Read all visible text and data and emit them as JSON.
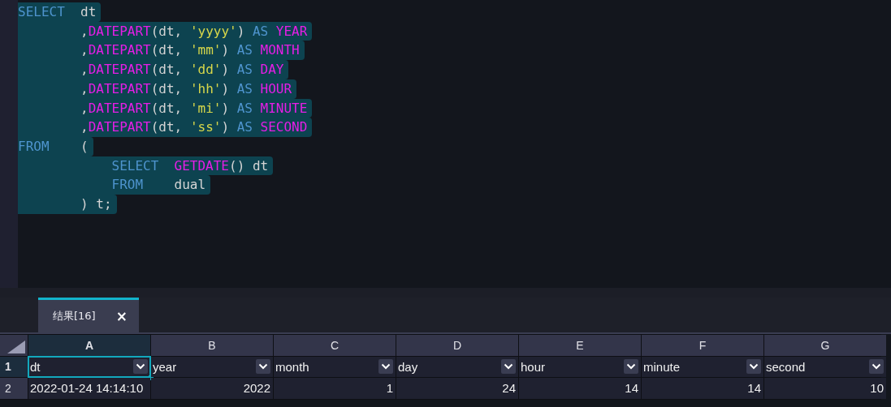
{
  "editor": {
    "lines": [
      {
        "kind": "clause",
        "tokens": [
          {
            "kind": "keyword",
            "text": "SELECT"
          },
          {
            "kind": "plain",
            "text": "  dt"
          }
        ]
      },
      {
        "kind": "item",
        "tokens": [
          {
            "kind": "plain",
            "text": ","
          },
          {
            "kind": "function",
            "text": "DATEPART"
          },
          {
            "kind": "plain",
            "text": "(dt, "
          },
          {
            "kind": "string",
            "text": "'yyyy'"
          },
          {
            "kind": "plain",
            "text": ") "
          },
          {
            "kind": "keyword",
            "text": "AS"
          },
          {
            "kind": "function",
            "text": " YEAR"
          }
        ]
      },
      {
        "kind": "item",
        "tokens": [
          {
            "kind": "plain",
            "text": ","
          },
          {
            "kind": "function",
            "text": "DATEPART"
          },
          {
            "kind": "plain",
            "text": "(dt, "
          },
          {
            "kind": "string",
            "text": "'mm'"
          },
          {
            "kind": "plain",
            "text": ") "
          },
          {
            "kind": "keyword",
            "text": "AS"
          },
          {
            "kind": "function",
            "text": " MONTH"
          }
        ]
      },
      {
        "kind": "item",
        "tokens": [
          {
            "kind": "plain",
            "text": ","
          },
          {
            "kind": "function",
            "text": "DATEPART"
          },
          {
            "kind": "plain",
            "text": "(dt, "
          },
          {
            "kind": "string",
            "text": "'dd'"
          },
          {
            "kind": "plain",
            "text": ") "
          },
          {
            "kind": "keyword",
            "text": "AS"
          },
          {
            "kind": "function",
            "text": " DAY"
          }
        ]
      },
      {
        "kind": "item",
        "tokens": [
          {
            "kind": "plain",
            "text": ","
          },
          {
            "kind": "function",
            "text": "DATEPART"
          },
          {
            "kind": "plain",
            "text": "(dt, "
          },
          {
            "kind": "string",
            "text": "'hh'"
          },
          {
            "kind": "plain",
            "text": ") "
          },
          {
            "kind": "keyword",
            "text": "AS"
          },
          {
            "kind": "function",
            "text": " HOUR"
          }
        ]
      },
      {
        "kind": "item",
        "tokens": [
          {
            "kind": "plain",
            "text": ","
          },
          {
            "kind": "function",
            "text": "DATEPART"
          },
          {
            "kind": "plain",
            "text": "(dt, "
          },
          {
            "kind": "string",
            "text": "'mi'"
          },
          {
            "kind": "plain",
            "text": ") "
          },
          {
            "kind": "keyword",
            "text": "AS"
          },
          {
            "kind": "function",
            "text": " MINUTE"
          }
        ]
      },
      {
        "kind": "item",
        "tokens": [
          {
            "kind": "plain",
            "text": ","
          },
          {
            "kind": "function",
            "text": "DATEPART"
          },
          {
            "kind": "plain",
            "text": "(dt, "
          },
          {
            "kind": "string",
            "text": "'ss'"
          },
          {
            "kind": "plain",
            "text": ") "
          },
          {
            "kind": "keyword",
            "text": "AS"
          },
          {
            "kind": "function",
            "text": " SECOND"
          }
        ]
      },
      {
        "kind": "clause",
        "tokens": [
          {
            "kind": "keyword",
            "text": "FROM"
          },
          {
            "kind": "plain",
            "text": "    ("
          }
        ]
      },
      {
        "kind": "subquery",
        "tokens": [
          {
            "kind": "keyword",
            "text": "SELECT"
          },
          {
            "kind": "function",
            "text": "  GETDATE"
          },
          {
            "kind": "plain",
            "text": "() dt"
          }
        ]
      },
      {
        "kind": "subquery",
        "tokens": [
          {
            "kind": "keyword",
            "text": "FROM"
          },
          {
            "kind": "plain",
            "text": "    dual"
          }
        ]
      },
      {
        "kind": "item",
        "tokens": [
          {
            "kind": "plain",
            "text": ") t;"
          }
        ]
      }
    ]
  },
  "result_tabs": [
    {
      "label": "结果[16]",
      "close": "×",
      "selected": true
    }
  ],
  "grid": {
    "columns": [
      {
        "letter": "A",
        "selected": true
      },
      {
        "letter": "B",
        "selected": false
      },
      {
        "letter": "C",
        "selected": false
      },
      {
        "letter": "D",
        "selected": false
      },
      {
        "letter": "E",
        "selected": false
      },
      {
        "letter": "F",
        "selected": false
      },
      {
        "letter": "G",
        "selected": false
      }
    ],
    "rows": [
      {
        "number": "1",
        "selected": true,
        "cells": [
          {
            "kind": "filter",
            "text": "dt",
            "selected": true
          },
          {
            "kind": "filter",
            "text": "year",
            "selected": false
          },
          {
            "kind": "filter",
            "text": "month",
            "selected": false
          },
          {
            "kind": "filter",
            "text": "day",
            "selected": false
          },
          {
            "kind": "filter",
            "text": "hour",
            "selected": false
          },
          {
            "kind": "filter",
            "text": "minute",
            "selected": false
          },
          {
            "kind": "filter",
            "text": "second",
            "selected": false
          }
        ]
      },
      {
        "number": "2",
        "selected": false,
        "cells": [
          {
            "kind": "text",
            "text": "2022-01-24 14:14:10",
            "selected": false
          },
          {
            "kind": "number",
            "text": "2022",
            "selected": false
          },
          {
            "kind": "number",
            "text": "1",
            "selected": false
          },
          {
            "kind": "number",
            "text": "24",
            "selected": false
          },
          {
            "kind": "number",
            "text": "14",
            "selected": false
          },
          {
            "kind": "number",
            "text": "14",
            "selected": false
          },
          {
            "kind": "number",
            "text": "10",
            "selected": false
          }
        ]
      }
    ]
  }
}
